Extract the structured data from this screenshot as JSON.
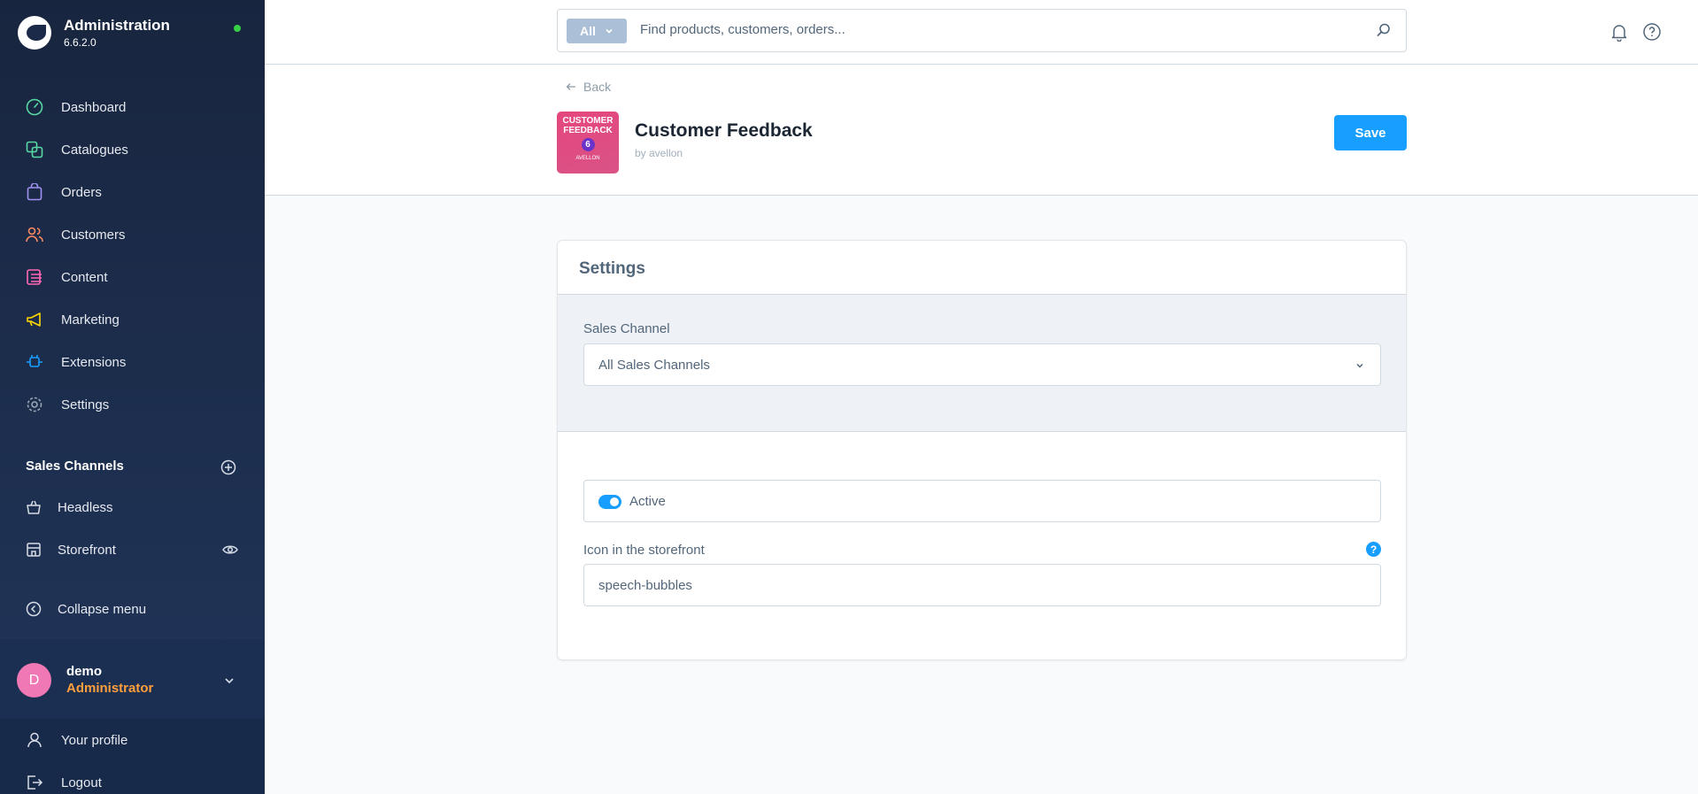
{
  "brand": {
    "title": "Administration",
    "version": "6.6.2.0"
  },
  "nav": [
    {
      "label": "Dashboard",
      "icon": "dashboard-icon",
      "color": "#57d9a3"
    },
    {
      "label": "Catalogues",
      "icon": "catalogue-icon",
      "color": "#57d9a3"
    },
    {
      "label": "Orders",
      "icon": "orders-icon",
      "color": "#a092f0"
    },
    {
      "label": "Customers",
      "icon": "customers-icon",
      "color": "#f88962"
    },
    {
      "label": "Content",
      "icon": "content-icon",
      "color": "#ff68b4"
    },
    {
      "label": "Marketing",
      "icon": "marketing-icon",
      "color": "#ffd700"
    },
    {
      "label": "Extensions",
      "icon": "extensions-icon",
      "color": "#189eff"
    },
    {
      "label": "Settings",
      "icon": "settings-icon",
      "color": "#9aa8b5"
    }
  ],
  "sales_channels": {
    "title": "Sales Channels",
    "items": [
      {
        "label": "Headless",
        "icon": "basket-icon"
      },
      {
        "label": "Storefront",
        "icon": "storefront-icon"
      }
    ]
  },
  "collapse_label": "Collapse menu",
  "user": {
    "initial": "D",
    "name": "demo",
    "role": "Administrator"
  },
  "bottom_links": [
    {
      "label": "Your profile",
      "icon": "user-icon"
    },
    {
      "label": "Logout",
      "icon": "logout-icon"
    }
  ],
  "search": {
    "type_label": "All",
    "placeholder": "Find products, customers, orders..."
  },
  "header": {
    "back_label": "Back",
    "logo_text_line1": "CUSTOMER",
    "logo_text_line2": "FEEDBACK",
    "logo_badge": "6",
    "logo_text_line3": "AVELLON",
    "title": "Customer Feedback",
    "author": "by avellon",
    "save_label": "Save"
  },
  "settings": {
    "title": "Settings",
    "sales_channel_label": "Sales Channel",
    "sales_channel_value": "All Sales Channels",
    "active_label": "Active",
    "active": true,
    "icon_label": "Icon in the storefront",
    "icon_value": "speech-bubbles",
    "help_glyph": "?"
  },
  "colors": {
    "accent": "#189eff",
    "role": "#ff9e3c",
    "avatar": "#f078b4",
    "online": "#37d046"
  }
}
